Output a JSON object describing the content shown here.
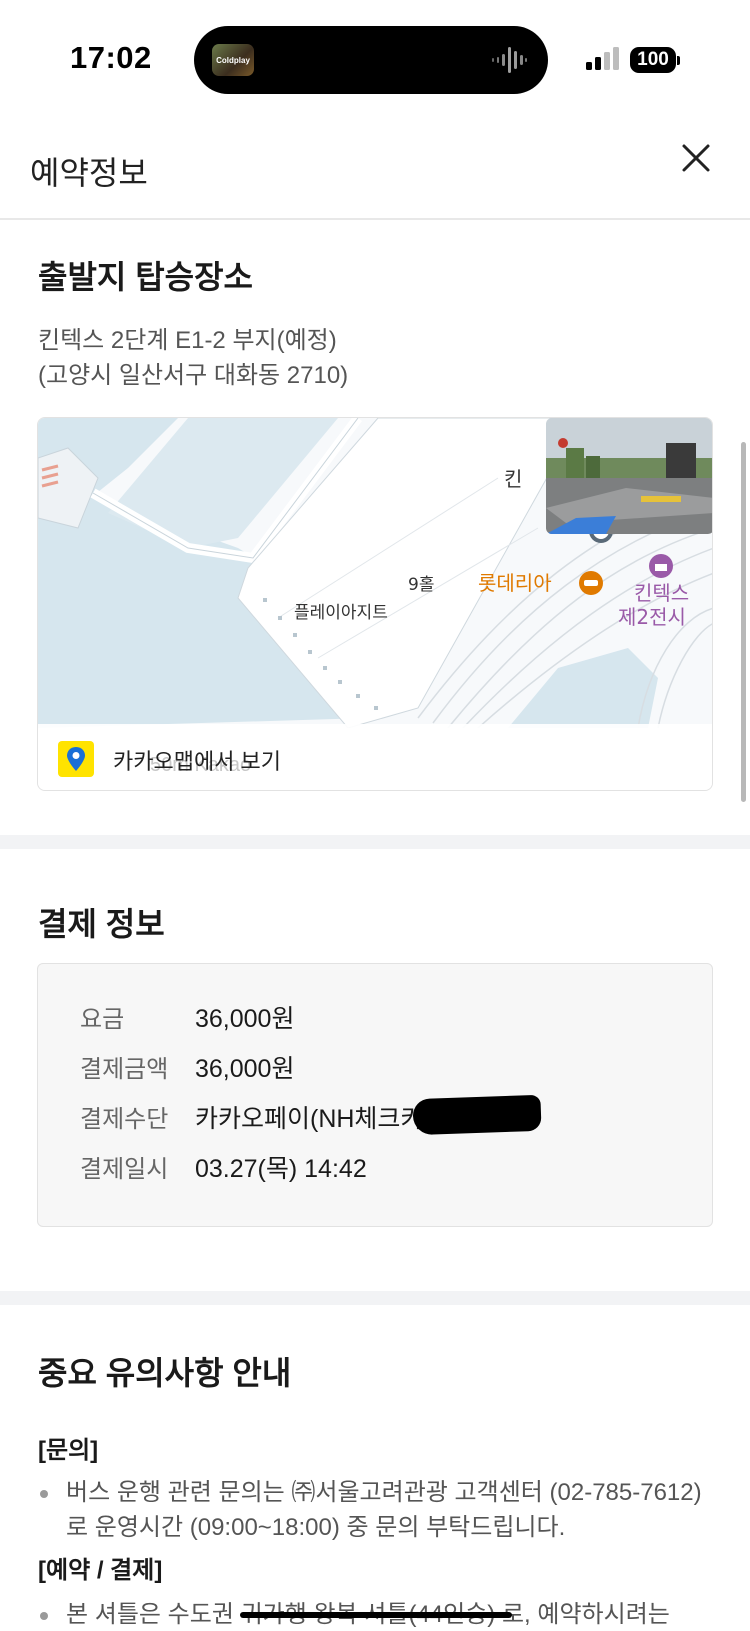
{
  "status_bar": {
    "time": "17:02",
    "now_playing_label": "Coldplay",
    "battery": "100"
  },
  "header": {
    "title": "예약정보",
    "close_icon": "close-icon"
  },
  "departure": {
    "title": "출발지 탑승장소",
    "address_line1": "킨텍스 2단계 E1-2 부지(예정)",
    "address_line2": "(고양시 일산서구 대화동 2710)"
  },
  "map": {
    "labels": {
      "hall": "9홀",
      "place": "플레이아지트",
      "restaurant": "롯데리아",
      "kintex": "킨텍스",
      "kintex_hall": "제2전시",
      "kintex_top": "킨"
    },
    "open_link": "카카오맵에서 보기",
    "scale": "50m  Kakao",
    "colors": {
      "water": "#d9e8f0",
      "land": "#f7f9fb",
      "accent": "#e07a00",
      "poi": "#9a5aa8"
    }
  },
  "payment": {
    "title": "결제 정보",
    "rows": [
      {
        "label": "요금",
        "value": "36,000원"
      },
      {
        "label": "결제금액",
        "value": "36,000원"
      },
      {
        "label": "결제수단",
        "value": "카카오페이(NH체크카"
      },
      {
        "label": "결제일시",
        "value": "03.27(목) 14:42"
      }
    ]
  },
  "notice": {
    "title": "중요 유의사항 안내",
    "inquiry_heading": "[문의]",
    "inquiry_text": "버스 운행 관련 문의는 ㈜서울고려관광 고객센터 (02-785-7612)로 운영시간 (09:00~18:00) 중 문의 부탁드립니다.",
    "payment_heading": "[예약 / 결제]",
    "payment_text": "본 셔틀은 수도권 귀가행 왕복 셔틀(44인승) 로, 예약하시려는"
  }
}
